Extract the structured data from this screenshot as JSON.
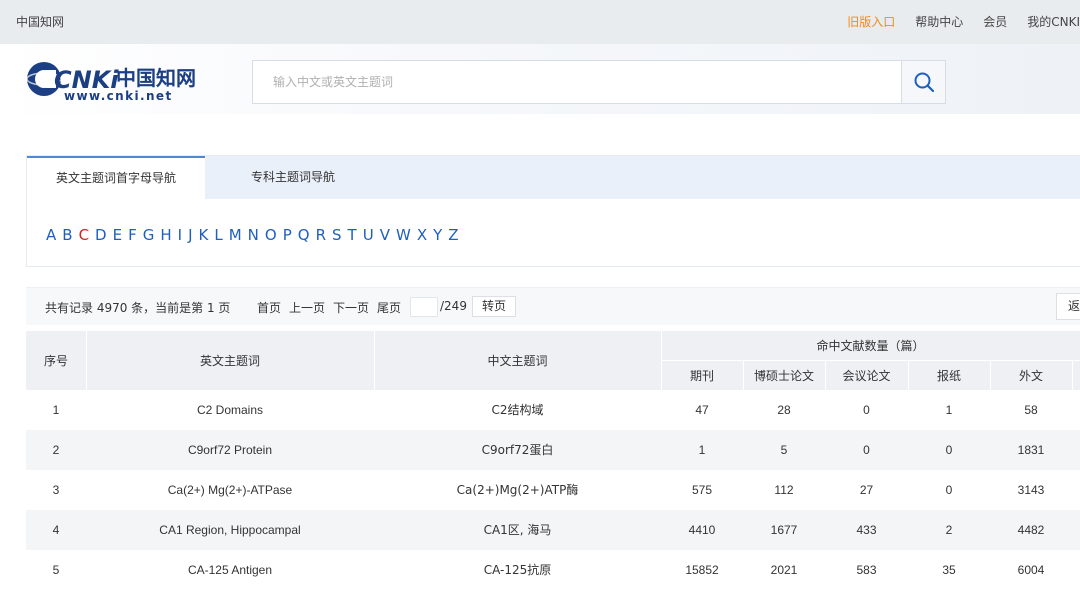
{
  "topbar": {
    "brand": "中国知网",
    "links": [
      "旧版入口",
      "帮助中心",
      "会员",
      "我的CNKI"
    ]
  },
  "logo": {
    "mark": "CNKi",
    "chinese": "中国知网",
    "url_text": "www.cnki.net"
  },
  "search": {
    "placeholder": "输入中文或英文主题词",
    "value": "",
    "icon": "search-icon"
  },
  "tabs": {
    "active": "英文主题词首字母导航",
    "other": "专科主题词导航"
  },
  "letters": [
    "A",
    "B",
    "C",
    "D",
    "E",
    "F",
    "G",
    "H",
    "I",
    "J",
    "K",
    "L",
    "M",
    "N",
    "O",
    "P",
    "Q",
    "R",
    "S",
    "T",
    "U",
    "V",
    "W",
    "X",
    "Y",
    "Z"
  ],
  "selected_letter": "C",
  "pager": {
    "count_text": "共有记录 4970 条，当前是第 1 页",
    "first": "首页",
    "prev": "上一页",
    "next": "下一页",
    "last": "尾页",
    "page_input": "",
    "total": "/249",
    "go": "转页",
    "return": "返回"
  },
  "table": {
    "headers": {
      "index": "序号",
      "en": "英文主题词",
      "zh": "中文主题词",
      "group": "命中文献数量（篇）",
      "sub": [
        "期刊",
        "博硕士论文",
        "会议论文",
        "报纸",
        "外文"
      ]
    },
    "rows": [
      {
        "index": "1",
        "en": "C2 Domains",
        "zh": "C2结构域",
        "journal": "47",
        "thesis": "28",
        "conf": "0",
        "news": "1",
        "foreign": "58"
      },
      {
        "index": "2",
        "en": "C9orf72 Protein",
        "zh": "C9orf72蛋白",
        "journal": "1",
        "thesis": "5",
        "conf": "0",
        "news": "0",
        "foreign": "1831"
      },
      {
        "index": "3",
        "en": "Ca(2+) Mg(2+)-ATPase",
        "zh": "Ca(2+)Mg(2+)ATP酶",
        "journal": "575",
        "thesis": "112",
        "conf": "27",
        "news": "0",
        "foreign": "3143"
      },
      {
        "index": "4",
        "en": "CA1 Region, Hippocampal",
        "zh": "CA1区, 海马",
        "journal": "4410",
        "thesis": "1677",
        "conf": "433",
        "news": "2",
        "foreign": "4482"
      },
      {
        "index": "5",
        "en": "CA-125 Antigen",
        "zh": "CA-125抗原",
        "journal": "15852",
        "thesis": "2021",
        "conf": "583",
        "news": "35",
        "foreign": "6004"
      }
    ]
  },
  "colors": {
    "link_blue": "#1f5fbd",
    "selected_red": "#d0261d",
    "old_entry_orange": "#f08a1e",
    "tab_accent": "#4b8bd6"
  }
}
